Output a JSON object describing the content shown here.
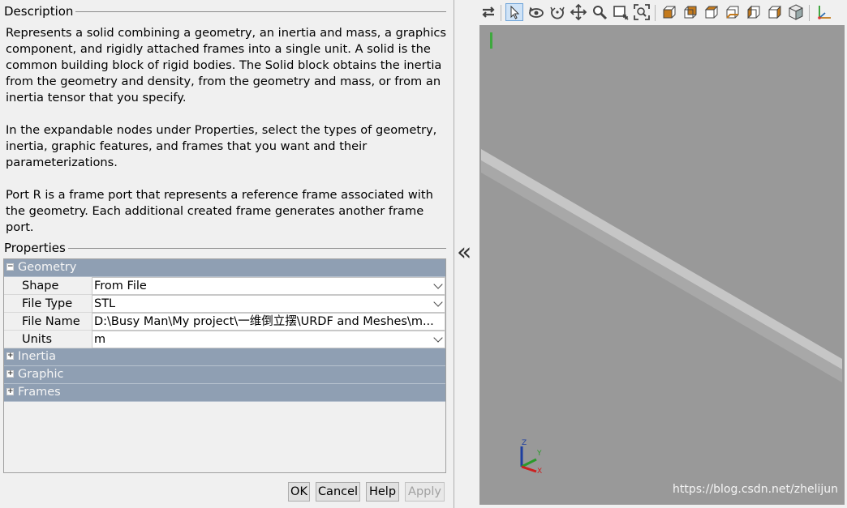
{
  "description": {
    "title": "Description",
    "paragraphs": [
      "Represents a solid combining a geometry, an inertia and mass, a graphics component, and rigidly attached frames into a single unit. A solid is the common building block of rigid bodies. The Solid block obtains the inertia from the geometry and density, from the geometry and mass, or from an inertia tensor that you specify.",
      "In the expandable nodes under Properties, select the types of geometry, inertia, graphic features, and frames that you want and their parameterizations.",
      "Port R is a frame port that represents a reference frame associated with the geometry. Each additional created frame generates another frame port."
    ]
  },
  "properties": {
    "title": "Properties",
    "geometry": {
      "label": "Geometry",
      "toggle": "−",
      "rows": [
        {
          "name": "Shape",
          "value": "From File"
        },
        {
          "name": "File Type",
          "value": "STL"
        },
        {
          "name": "File Name",
          "value": "D:\\Busy Man\\My project\\一维倒立摆\\URDF and Meshes\\m..."
        },
        {
          "name": "Units",
          "value": "m"
        }
      ]
    },
    "inertia": {
      "label": "Inertia",
      "toggle": "+"
    },
    "graphic": {
      "label": "Graphic",
      "toggle": "+"
    },
    "frames": {
      "label": "Frames",
      "toggle": "+"
    }
  },
  "buttons": {
    "ok": "OK",
    "cancel": "Cancel",
    "help": "Help",
    "apply": "Apply"
  },
  "divider": {
    "collapse_glyph": "«"
  },
  "toolbar": {
    "icons": [
      "swap-icon",
      "select-arrow-icon",
      "rotate-icon",
      "roll-icon",
      "pan-icon",
      "zoom-icon",
      "zoom-box-icon",
      "fit-view-icon",
      "front-view-icon",
      "back-view-icon",
      "left-view-icon",
      "right-view-icon",
      "top-view-icon",
      "bottom-view-icon",
      "isometric-view-icon",
      "triad-icon"
    ]
  },
  "viewport": {
    "background": "#999999",
    "triad": {
      "z": "Z",
      "y": "Y",
      "x": "X"
    },
    "watermark": "https://blog.csdn.net/zhelijun"
  },
  "colors": {
    "section_header": "#8f9fb3",
    "accent_orange": "#c47a1c",
    "toolbar_blue": "#2b6cb0"
  }
}
